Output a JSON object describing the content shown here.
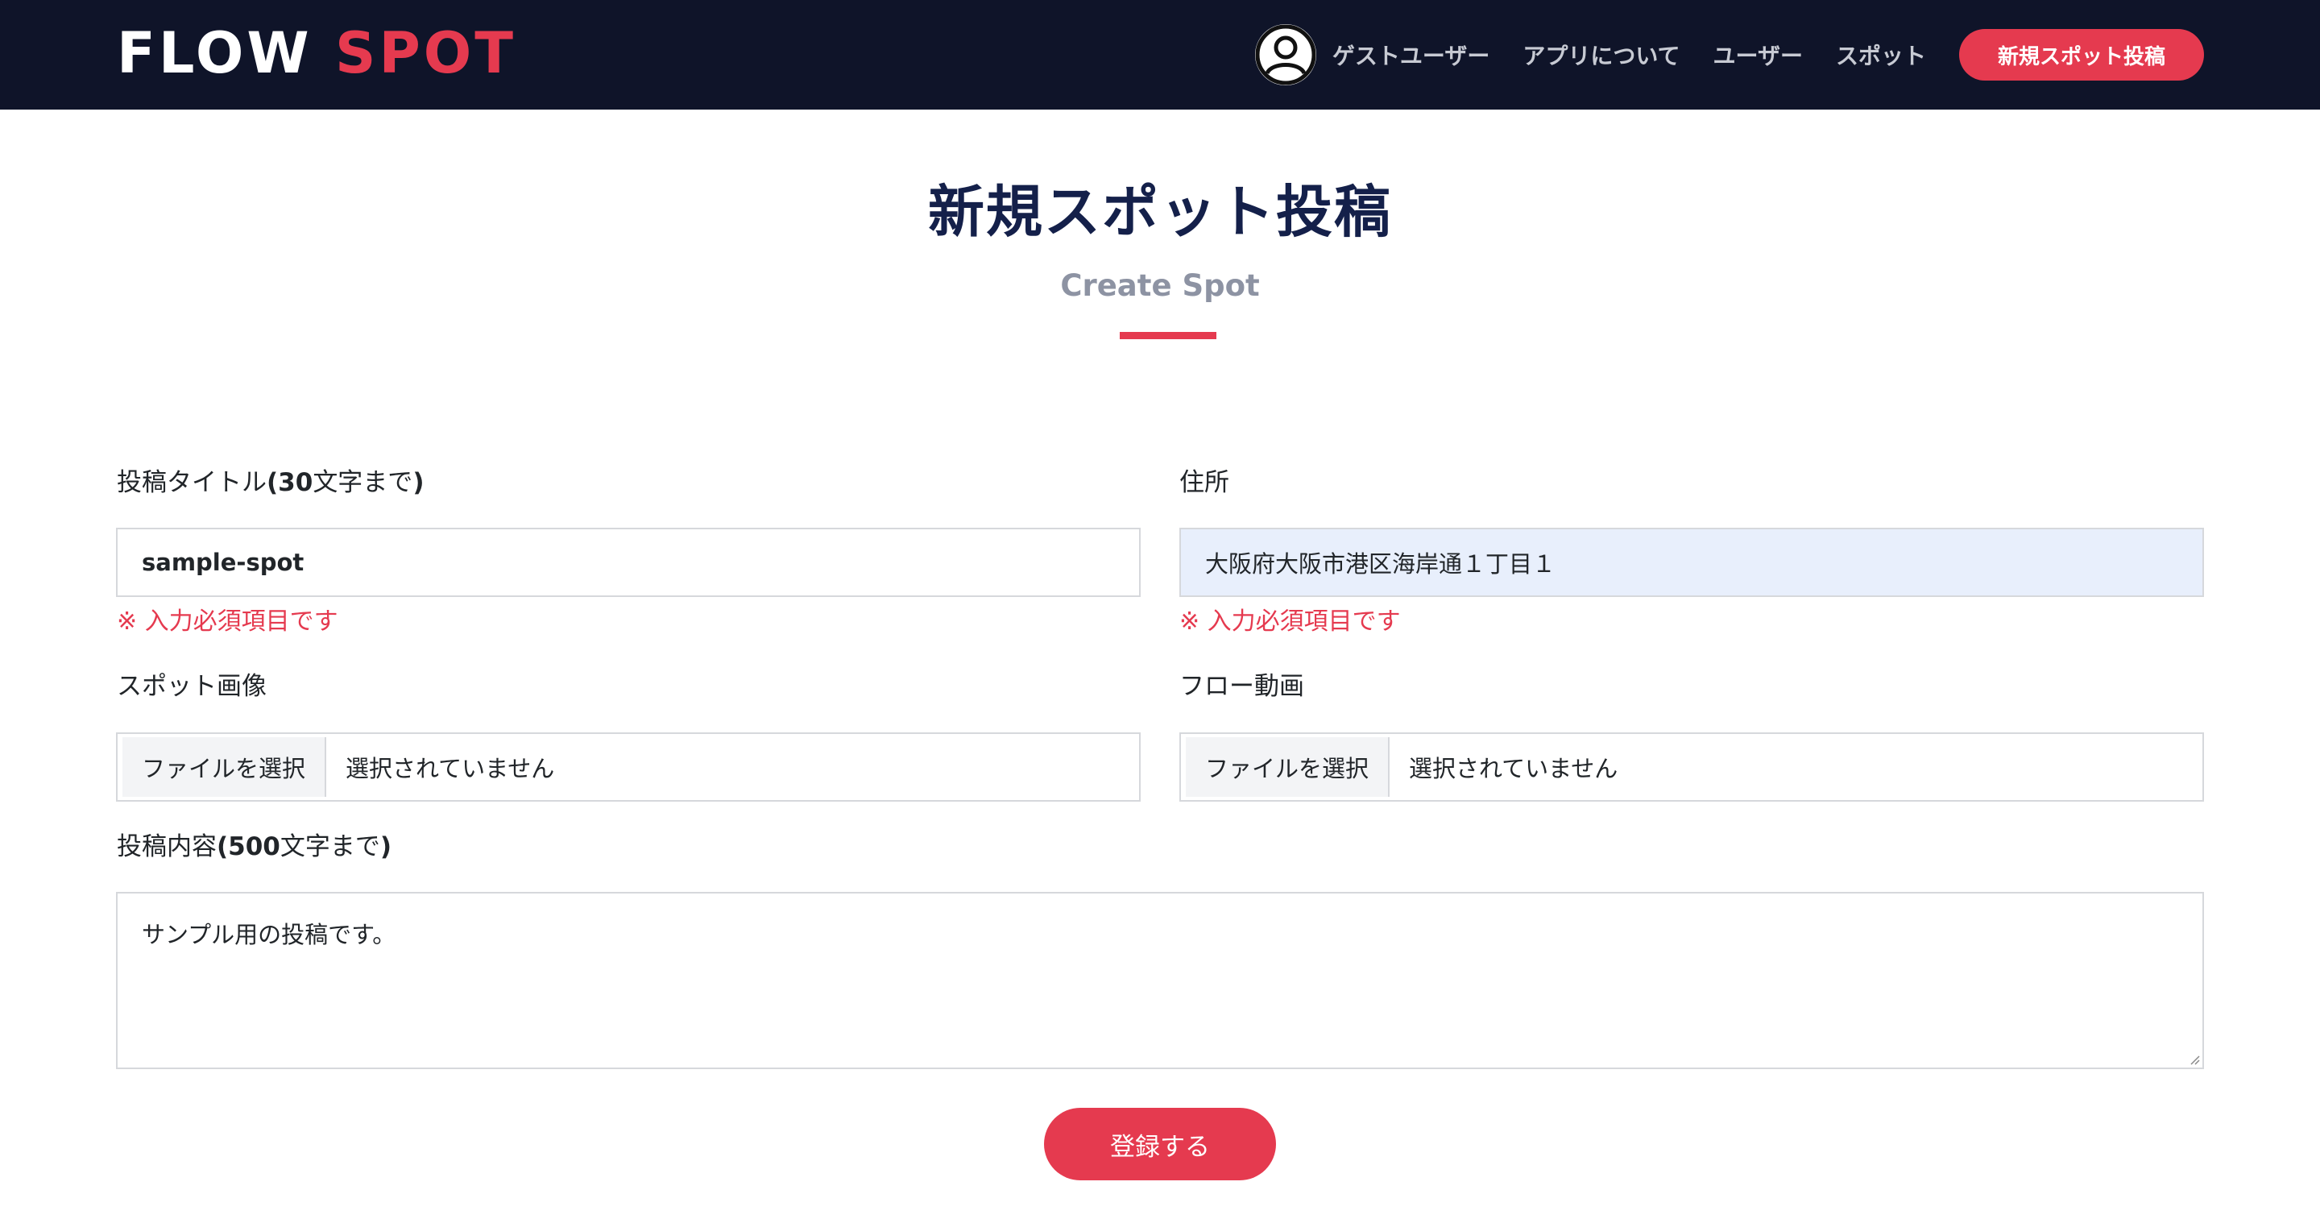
{
  "header": {
    "logo_part1": "FLOW",
    "logo_part2": "SPOT",
    "user_name": "ゲストユーザー",
    "nav": {
      "about": "アプリについて",
      "users": "ユーザー",
      "spots": "スポット"
    },
    "cta_label": "新規スポット投稿"
  },
  "page": {
    "title": "新規スポット投稿",
    "subtitle": "Create Spot"
  },
  "form": {
    "title_label_prefix": "投稿タイトル",
    "title_label_bold": "(30",
    "title_label_mid": "文字まで",
    "title_label_end": ")",
    "title_value": "sample-spot",
    "title_error": "※ 入力必須項目です",
    "address_label": "住所",
    "address_value": "大阪府大阪市港区海岸通１丁目１",
    "address_error": "※ 入力必須項目です",
    "image_label": "スポット画像",
    "image_button": "ファイルを選択",
    "image_status": "選択されていません",
    "video_label": "フロー動画",
    "video_button": "ファイルを選択",
    "video_status": "選択されていません",
    "content_label_prefix": "投稿内容",
    "content_label_bold": "(500",
    "content_label_mid": "文字まで",
    "content_label_end": ")",
    "content_value": "サンプル用の投稿です。",
    "submit_label": "登録する"
  },
  "colors": {
    "navbar": "#0f1429",
    "accent": "#e53a4f",
    "title": "#14204a",
    "subtitle": "#8d93a3",
    "autofill": "#e8effc"
  },
  "icons": {
    "avatar": "user-circle-icon",
    "resize": "resize-grip-icon"
  }
}
